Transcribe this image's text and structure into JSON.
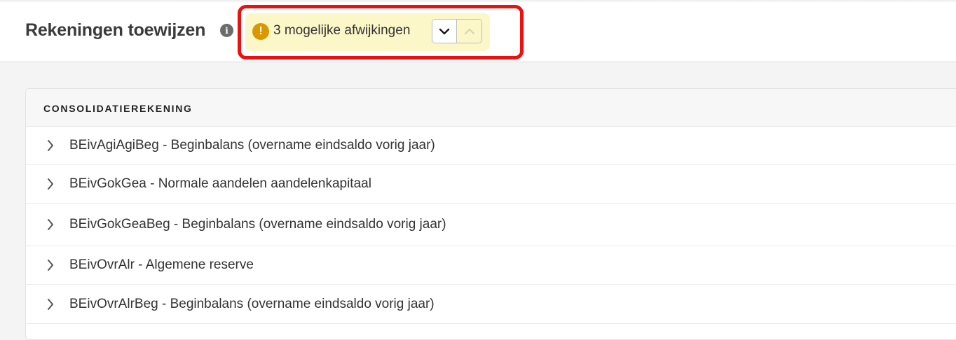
{
  "header": {
    "title": "Rekeningen toewijzen",
    "info_icon": "info-icon",
    "info_glyph": "i",
    "warning": {
      "icon": "exclamation-icon",
      "glyph": "!",
      "text": "3 mogelijke afwijkingen",
      "accent_color": "#d99800",
      "background_color": "#fbf7c9"
    },
    "highlight_color": "#ee0f0f",
    "nav_buttons": [
      {
        "icon": "chevron-down-icon",
        "enabled": true
      },
      {
        "icon": "chevron-up-icon",
        "enabled": false
      }
    ]
  },
  "table": {
    "column_header": "CONSOLIDATIEREKENING",
    "rows": [
      {
        "label": "BEivAgiAgiBeg - Beginbalans (overname eindsaldo vorig jaar)"
      },
      {
        "label": "BEivGokGea - Normale aandelen aandelenkapitaal"
      },
      {
        "label": "BEivGokGeaBeg - Beginbalans (overname eindsaldo vorig jaar)"
      },
      {
        "label": "BEivOvrAlr - Algemene reserve"
      },
      {
        "label": "BEivOvrAlrBeg - Beginbalans (overname eindsaldo vorig jaar)"
      }
    ]
  }
}
